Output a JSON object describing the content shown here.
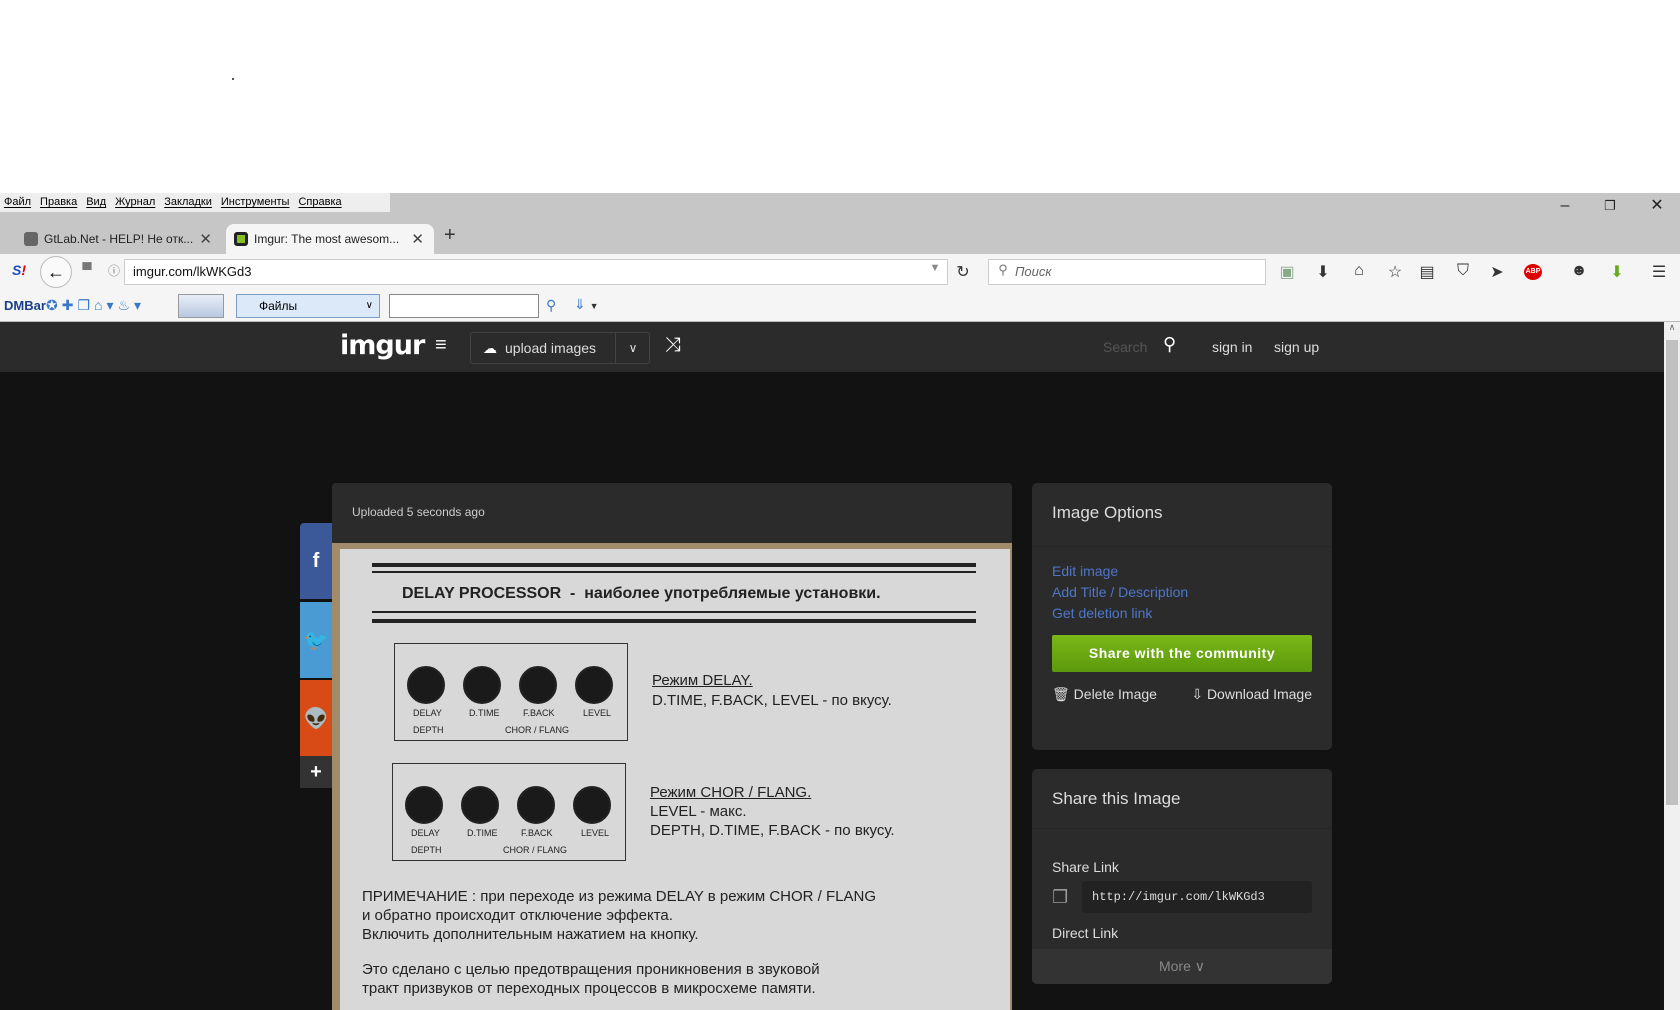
{
  "browser": {
    "menu": [
      "Файл",
      "Правка",
      "Вид",
      "Журнал",
      "Закладки",
      "Инструменты",
      "Справка"
    ],
    "tabs": [
      {
        "title": "GtLab.Net - HELP! Не отк..."
      },
      {
        "title": "Imgur: The most awesom..."
      }
    ],
    "url": "imgur.com/lkWKGd3",
    "search_placeholder": "Поиск",
    "bookmarks": {
      "dmbar": "DMBar",
      "dropdown": "Файлы",
      "input": ""
    }
  },
  "imgur": {
    "logo": "imgur",
    "upload": "upload images",
    "search": "Search",
    "sign_in": "sign in",
    "sign_up": "sign up",
    "uploaded": "Uploaded 5 seconds ago",
    "options": {
      "title": "Image Options",
      "links": [
        "Edit image",
        "Add Title / Description",
        "Get deletion link"
      ],
      "share_button": "Share with the community",
      "delete": "Delete Image",
      "download": "Download Image"
    },
    "share": {
      "title": "Share this Image",
      "share_link_label": "Share Link",
      "share_link": "http://imgur.com/lkWKGd3",
      "direct_link_label": "Direct Link",
      "more": "More"
    },
    "colors": {
      "green": "#5fa30f",
      "link": "#4e76c9",
      "facebook": "#3b5998",
      "twitter": "#4a9ad4",
      "reddit": "#d84b16"
    }
  },
  "photo": {
    "title": "DELAY PROCESSOR  -  наиболее употребляемые установки.",
    "knob_labels": [
      "DELAY",
      "D.TIME",
      "F.BACK",
      "LEVEL"
    ],
    "depth": "DEPTH",
    "chor": "CHOR / FLANG",
    "mode1_title": "Режим DELAY.",
    "mode1_text": "D.TIME, F.BACK, LEVEL - по вкусу.",
    "mode2_title": "Режим CHOR / FLANG.",
    "mode2_line1": "LEVEL - макс.",
    "mode2_line2": "DEPTH, D.TIME, F.BACK - по вкусу.",
    "note1": "ПРИМЕЧАНИЕ : при переходе из режима DELAY в режим CHOR / FLANG",
    "note2": "и обратно происходит отключение эффекта.",
    "note3": "Включить дополнительным нажатием на кнопку.",
    "note4": "Это сделано с целью предотвращения проникновения в звуковой",
    "note5": "тракт призвуков от переходных процессов в микросхеме памяти."
  }
}
